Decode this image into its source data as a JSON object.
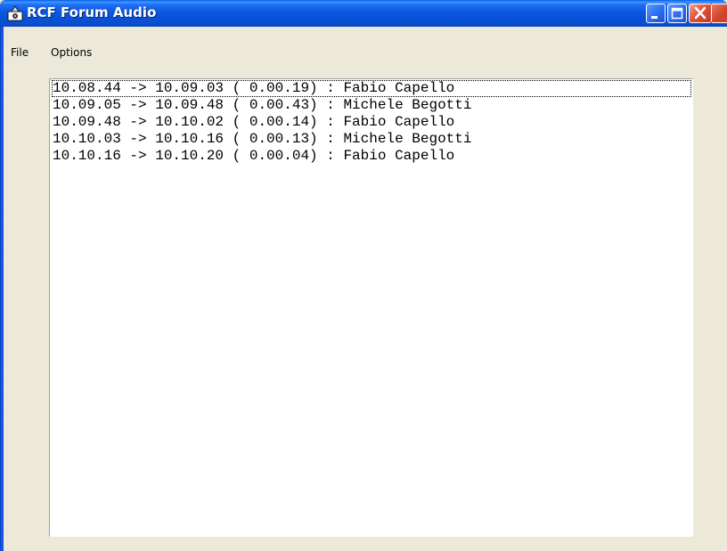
{
  "window": {
    "title": "RCF Forum Audio",
    "app_icon": "speaker-icon",
    "controls": {
      "minimize_icon": "minimize-icon",
      "maximize_icon": "maximize-icon",
      "close_icon": "close-icon"
    },
    "colors": {
      "titlebar": "#0a5fe6",
      "close_button": "#e0533a",
      "window_background": "#ece9d8",
      "list_background": "#ffffff"
    }
  },
  "menu": {
    "items": [
      {
        "label": "File"
      },
      {
        "label": "Options"
      }
    ]
  },
  "log": {
    "entries": [
      {
        "text": "10.08.44 -> 10.09.03 ( 0.00.19) : Fabio Capello",
        "start": "10.08.44",
        "end": "10.09.03",
        "duration": "0.00.19",
        "speaker": "Fabio Capello",
        "focused": true
      },
      {
        "text": "10.09.05 -> 10.09.48 ( 0.00.43) : Michele Begotti",
        "start": "10.09.05",
        "end": "10.09.48",
        "duration": "0.00.43",
        "speaker": "Michele Begotti",
        "focused": false
      },
      {
        "text": "10.09.48 -> 10.10.02 ( 0.00.14) : Fabio Capello",
        "start": "10.09.48",
        "end": "10.10.02",
        "duration": "0.00.14",
        "speaker": "Fabio Capello",
        "focused": false
      },
      {
        "text": "10.10.03 -> 10.10.16 ( 0.00.13) : Michele Begotti",
        "start": "10.10.03",
        "end": "10.10.16",
        "duration": "0.00.13",
        "speaker": "Michele Begotti",
        "focused": false
      },
      {
        "text": "10.10.16 -> 10.10.20 ( 0.00.04) : Fabio Capello",
        "start": "10.10.16",
        "end": "10.10.20",
        "duration": "0.00.04",
        "speaker": "Fabio Capello",
        "focused": false
      }
    ]
  }
}
